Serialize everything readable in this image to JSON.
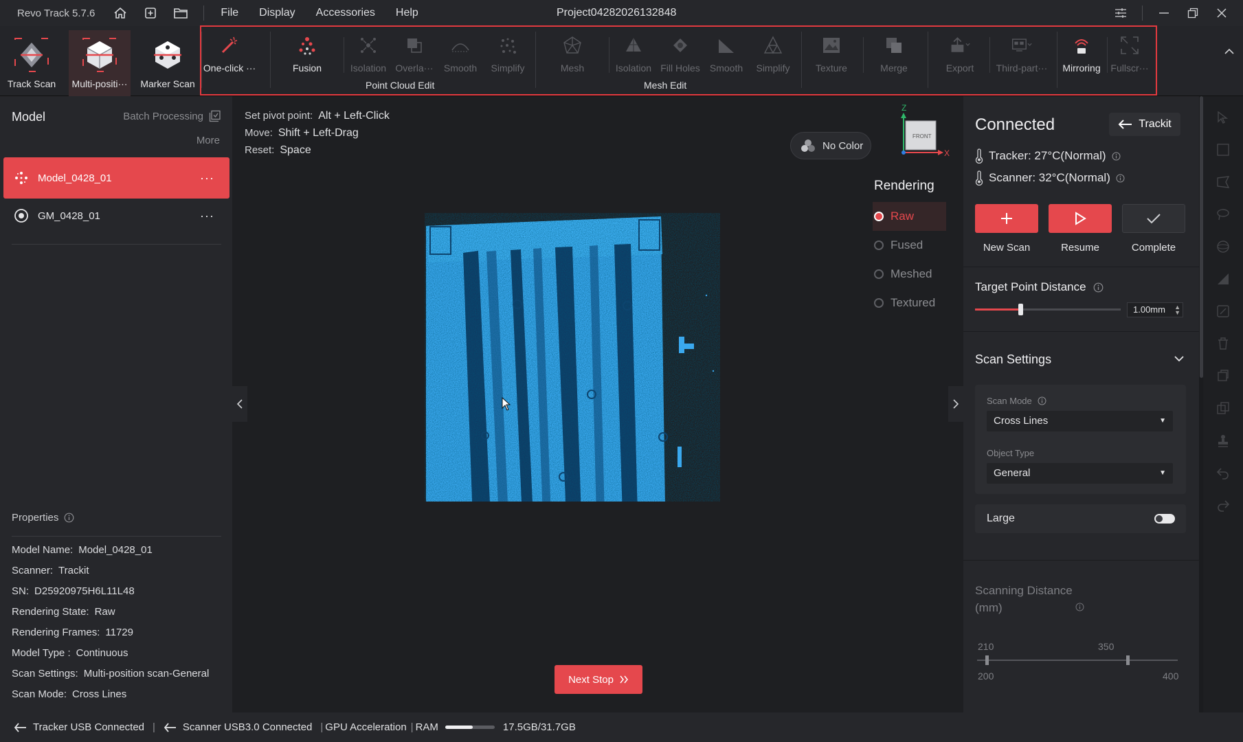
{
  "titlebar": {
    "app_version": "Revo Track 5.7.6",
    "menu": [
      "File",
      "Display",
      "Accessories",
      "Help"
    ],
    "project": "Project04282026132848"
  },
  "ribbon": {
    "modes": [
      {
        "label": "Track Scan",
        "icon": "track-scan-icon"
      },
      {
        "label": "Multi-positi···",
        "icon": "multi-position-icon",
        "active": true
      },
      {
        "label": "Marker Scan",
        "icon": "marker-scan-icon"
      }
    ],
    "tools": {
      "one_click": "One-click ···",
      "fusion": "Fusion",
      "pc_isolation": "Isolation",
      "overlap": "Overla···",
      "pc_smooth": "Smooth",
      "pc_simplify": "Simplify",
      "mesh": "Mesh",
      "mesh_isolation": "Isolation",
      "fill_holes": "Fill Holes",
      "mesh_smooth": "Smooth",
      "mesh_simplify": "Simplify",
      "texture": "Texture",
      "merge": "Merge",
      "export": "Export",
      "third_party": "Third-part···",
      "mirroring": "Mirroring",
      "fullscreen": "Fullscr···"
    },
    "groups": {
      "point_cloud": "Point Cloud Edit",
      "mesh": "Mesh Edit"
    }
  },
  "left_panel": {
    "title": "Model",
    "batch": "Batch Processing",
    "more": "More",
    "models": [
      {
        "name": "Model_0428_01",
        "selected": true,
        "dots": "···"
      },
      {
        "name": "GM_0428_01",
        "selected": false,
        "dots": "···"
      }
    ],
    "properties_title": "Properties",
    "properties": [
      {
        "k": "Model Name:",
        "v": "Model_0428_01"
      },
      {
        "k": "Scanner:",
        "v": "Trackit"
      },
      {
        "k": "SN:",
        "v": "D25920975H6L11L48"
      },
      {
        "k": "Rendering State:",
        "v": "Raw"
      },
      {
        "k": "Rendering Frames:",
        "v": "11729"
      },
      {
        "k": "Model Type :",
        "v": "Continuous"
      },
      {
        "k": "Scan Settings:",
        "v": "Multi-position scan-General"
      },
      {
        "k": "Scan Mode:",
        "v": "Cross Lines"
      }
    ]
  },
  "viewport": {
    "hints": [
      {
        "k": "Set pivot point:",
        "v": "Alt + Left-Click"
      },
      {
        "k": "Move:",
        "v": "Shift + Left-Drag"
      },
      {
        "k": "Reset:",
        "v": "Space"
      }
    ],
    "no_color": "No Color",
    "gizmo": {
      "z": "Z",
      "x": "X",
      "face": "FRONT"
    },
    "rendering_title": "Rendering",
    "rendering_options": [
      "Raw",
      "Fused",
      "Meshed",
      "Textured"
    ],
    "rendering_selected": "Raw",
    "next_stop": "Next Stop",
    "accent": "#e5484d",
    "cloud_color": "#3aa8ee"
  },
  "right_panel": {
    "status": "Connected",
    "device_button": "Trackit",
    "tracker_temp": "Tracker: 27°C(Normal)",
    "scanner_temp": "Scanner: 32°C(Normal)",
    "actions": [
      "New Scan",
      "Resume",
      "Complete"
    ],
    "target_point_distance": "Target Point Distance",
    "tpd_value": "1.00mm",
    "tpd_fraction": 0.31,
    "scan_settings": "Scan Settings",
    "scan_mode_label": "Scan Mode",
    "scan_mode": "Cross Lines",
    "object_type_label": "Object Type",
    "object_type": "General",
    "large_label": "Large",
    "scanning_distance": "Scanning Distance (mm)",
    "sd_values": {
      "low": "210",
      "high": "350",
      "min": "200",
      "max": "400"
    }
  },
  "statusbar": {
    "tracker": "Tracker USB Connected",
    "scanner": "Scanner USB3.0 Connected",
    "gpu": "GPU Acceleration",
    "ram_label": "RAM",
    "ram_value": "17.5GB/31.7GB",
    "ram_fraction": 0.55
  }
}
